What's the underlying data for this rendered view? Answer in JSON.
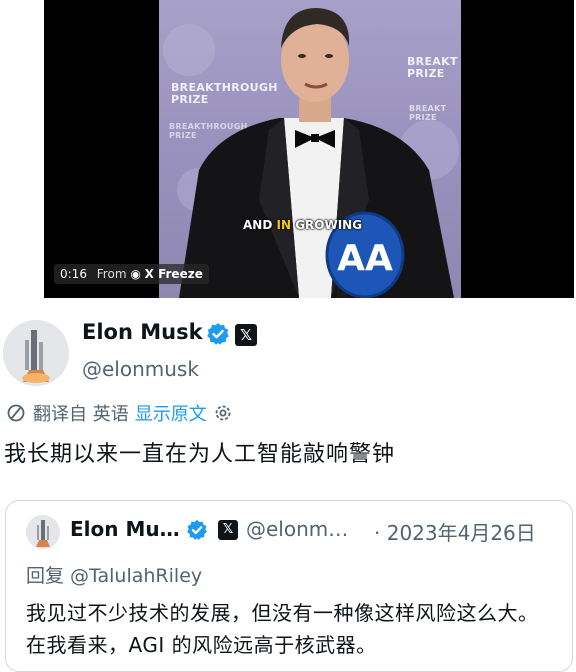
{
  "video": {
    "timestamp": "0:16",
    "from_label": "From",
    "source_icon": "broadcast-icon",
    "source_name": "X Freeze",
    "caption_pre": "AND",
    "caption_highlight": "IN",
    "caption_post": "GROWING",
    "backdrop_left_title": "BREAKTHROUGH",
    "backdrop_left_sub": "PRIZE",
    "backdrop_right_title": "BREAKT",
    "backdrop_right_sub": "PRIZE",
    "mic_logo": "AA"
  },
  "tweet": {
    "author_name": "Elon Musk",
    "author_handle": "@elonmusk",
    "verified_icon": "verified-badge-icon",
    "affiliation_badge": "𝕏",
    "translation": {
      "icon": "translate-icon",
      "label": "翻译自 英语",
      "show_original": "显示原文",
      "settings_icon": "gear-icon"
    },
    "text": "我长期以来一直在为人工智能敲响警钟"
  },
  "quoted_tweet": {
    "author_name": "Elon Mu…",
    "author_handle": "@elonm…",
    "affiliation_badge": "𝕏",
    "date": "· 2023年4月26日",
    "reply_to": "回复 @TalulahRiley",
    "text": "我见过不少技术的发展，但没有一种像这样风险这么大。在我看来，AGI 的风险远高于核武器。"
  },
  "colors": {
    "link": "#1d9bf0",
    "secondary_text": "#536471",
    "verified": "#1d9bf0",
    "caption_highlight": "#f4c900"
  }
}
